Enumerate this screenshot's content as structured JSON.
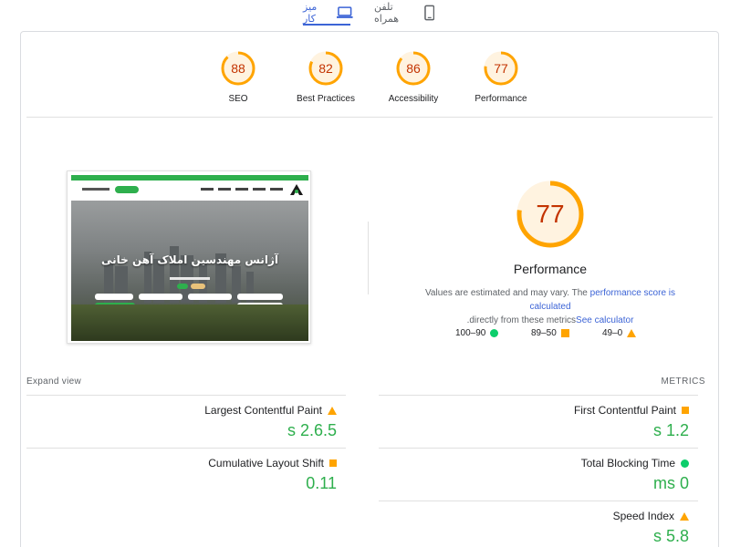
{
  "device_tabs": {
    "desktop_label": "میز کار",
    "mobile_label": "تلفن همراه"
  },
  "category_scores": [
    {
      "label": "SEO",
      "score": "88",
      "value": 88
    },
    {
      "label": "Best Practices",
      "score": "82",
      "value": 82
    },
    {
      "label": "Accessibility",
      "score": "86",
      "value": 86
    },
    {
      "label": "Performance",
      "score": "77",
      "value": 77
    }
  ],
  "thumbnail": {
    "hero_title": "آژانس مهندسین املاک آهن خانی"
  },
  "performance": {
    "score": "77",
    "value": 77,
    "title": "Performance",
    "note_prefix": "Values are estimated and may vary. The ",
    "note_link": "performance score is calculated",
    "note_middle": ".directly from these metrics",
    "note_link2": "See calculator"
  },
  "legend": {
    "good": "100–90",
    "average": "89–50",
    "poor": "49–0"
  },
  "metrics_section": {
    "expand_label": "Expand view",
    "title": "METRICS"
  },
  "metrics": {
    "lcp": {
      "name": "Largest Contentful Paint",
      "value": "s 2.6.5",
      "indicator": "triangle"
    },
    "cls": {
      "name": "Cumulative Layout Shift",
      "value": "0.11",
      "indicator": "square"
    },
    "fcp": {
      "name": "First Contentful Paint",
      "value": "s 1.2",
      "indicator": "square"
    },
    "tbt": {
      "name": "Total Blocking Time",
      "value": "ms 0",
      "indicator": "circle"
    },
    "si": {
      "name": "Speed Index",
      "value": "s 5.8",
      "indicator": "triangle"
    }
  },
  "colors": {
    "accent": "#3c64d6",
    "average": "#ffa400",
    "good": "#0cce6b",
    "score_text": "#c33300",
    "metric_value": "#2eaf4d"
  }
}
